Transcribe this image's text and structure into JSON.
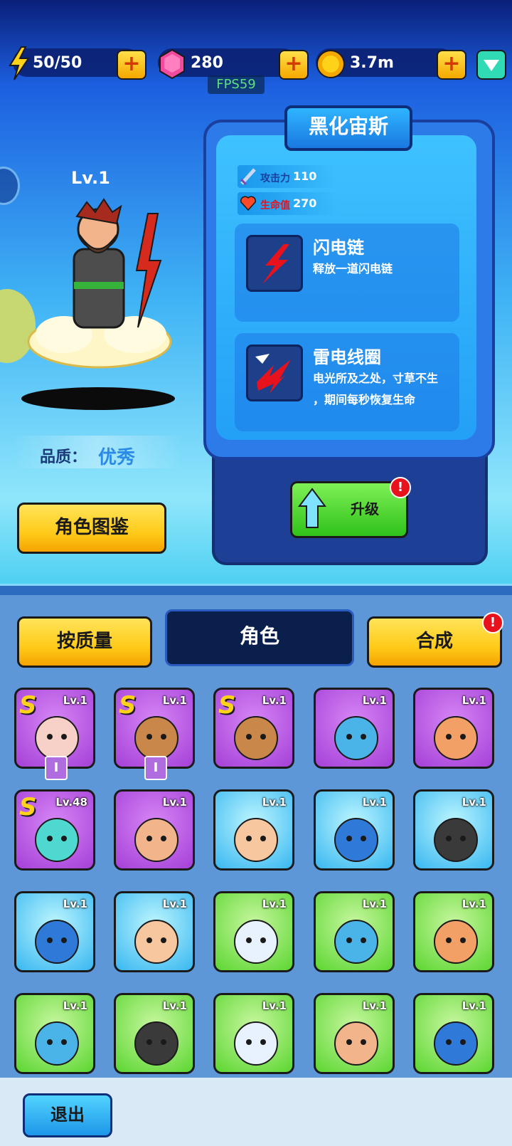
{
  "topbar": {
    "energy": "50/50",
    "gems": "280",
    "coins": "3.7m",
    "fps": "FPS59",
    "plus_label": "+"
  },
  "hero": {
    "level": "Lv.1",
    "quality_label": "品质：",
    "quality_value": "优秀",
    "gallery_button": "角色图鉴"
  },
  "info": {
    "name": "黑化宙斯",
    "stats": [
      {
        "label": "攻击力",
        "value": "110"
      },
      {
        "label": "生命值",
        "value": "270"
      }
    ],
    "skills": [
      {
        "name": "闪电链",
        "desc_lines": [
          "释放一道闪电链"
        ]
      },
      {
        "name": "雷电线圈",
        "desc_lines": [
          "电光所及之处，寸草不生",
          "，期间每秒恢复生命"
        ]
      }
    ],
    "upgrade_label": "升级",
    "badge": "!"
  },
  "tabs": {
    "sort_button": "按质量",
    "center": "角色",
    "compose_button": "合成",
    "badge": "!"
  },
  "grid": {
    "rows": [
      [
        {
          "rarity": "purple",
          "level": "Lv.1",
          "s": "S",
          "rank": "I",
          "face": "horned-girl"
        },
        {
          "rarity": "purple",
          "level": "Lv.1",
          "s": "S",
          "rank": "I",
          "face": "monkey"
        },
        {
          "rarity": "purple",
          "level": "Lv.1",
          "s": "S",
          "rank": "",
          "face": "monkey"
        },
        {
          "rarity": "purple",
          "level": "Lv.1",
          "s": "",
          "rank": "",
          "face": "blue-blob"
        },
        {
          "rarity": "purple",
          "level": "Lv.1",
          "s": "",
          "rank": "",
          "face": "orange-beard"
        }
      ],
      [
        {
          "rarity": "purple",
          "level": "Lv.48",
          "s": "S",
          "rank": "",
          "face": "teal-girl"
        },
        {
          "rarity": "purple",
          "level": "Lv.1",
          "s": "",
          "rank": "",
          "face": "monocle-man"
        },
        {
          "rarity": "blue",
          "level": "Lv.1",
          "s": "",
          "rank": "",
          "face": "chubby-man"
        },
        {
          "rarity": "blue",
          "level": "Lv.1",
          "s": "",
          "rank": "",
          "face": "blue-hair-girl"
        },
        {
          "rarity": "blue",
          "level": "Lv.1",
          "s": "",
          "rank": "",
          "face": "black-beard"
        }
      ],
      [
        {
          "rarity": "blue",
          "level": "Lv.1",
          "s": "",
          "rank": "",
          "face": "blue-hair-girl"
        },
        {
          "rarity": "blue",
          "level": "Lv.1",
          "s": "",
          "rank": "",
          "face": "chubby-man"
        },
        {
          "rarity": "green",
          "level": "Lv.1",
          "s": "",
          "rank": "",
          "face": "white-hair-girl"
        },
        {
          "rarity": "green",
          "level": "Lv.1",
          "s": "",
          "rank": "",
          "face": "blue-blob"
        },
        {
          "rarity": "green",
          "level": "Lv.1",
          "s": "",
          "rank": "",
          "face": "orange-beard"
        }
      ],
      [
        {
          "rarity": "green",
          "level": "Lv.1",
          "s": "",
          "rank": "",
          "face": "blue-blob"
        },
        {
          "rarity": "green",
          "level": "Lv.1",
          "s": "",
          "rank": "",
          "face": "black-beard"
        },
        {
          "rarity": "green",
          "level": "Lv.1",
          "s": "",
          "rank": "",
          "face": "white-hair-girl"
        },
        {
          "rarity": "green",
          "level": "Lv.1",
          "s": "",
          "rank": "",
          "face": "monocle-man"
        },
        {
          "rarity": "green",
          "level": "Lv.1",
          "s": "",
          "rank": "",
          "face": "blue-hair-girl"
        }
      ]
    ]
  },
  "footer": {
    "exit_button": "退出"
  },
  "colors": {
    "accent_yellow": "#ffcb1a",
    "purple_card": "#a540d8",
    "blue_card": "#38b7f0",
    "green_card": "#5cd631",
    "badge_red": "#e8121c"
  }
}
